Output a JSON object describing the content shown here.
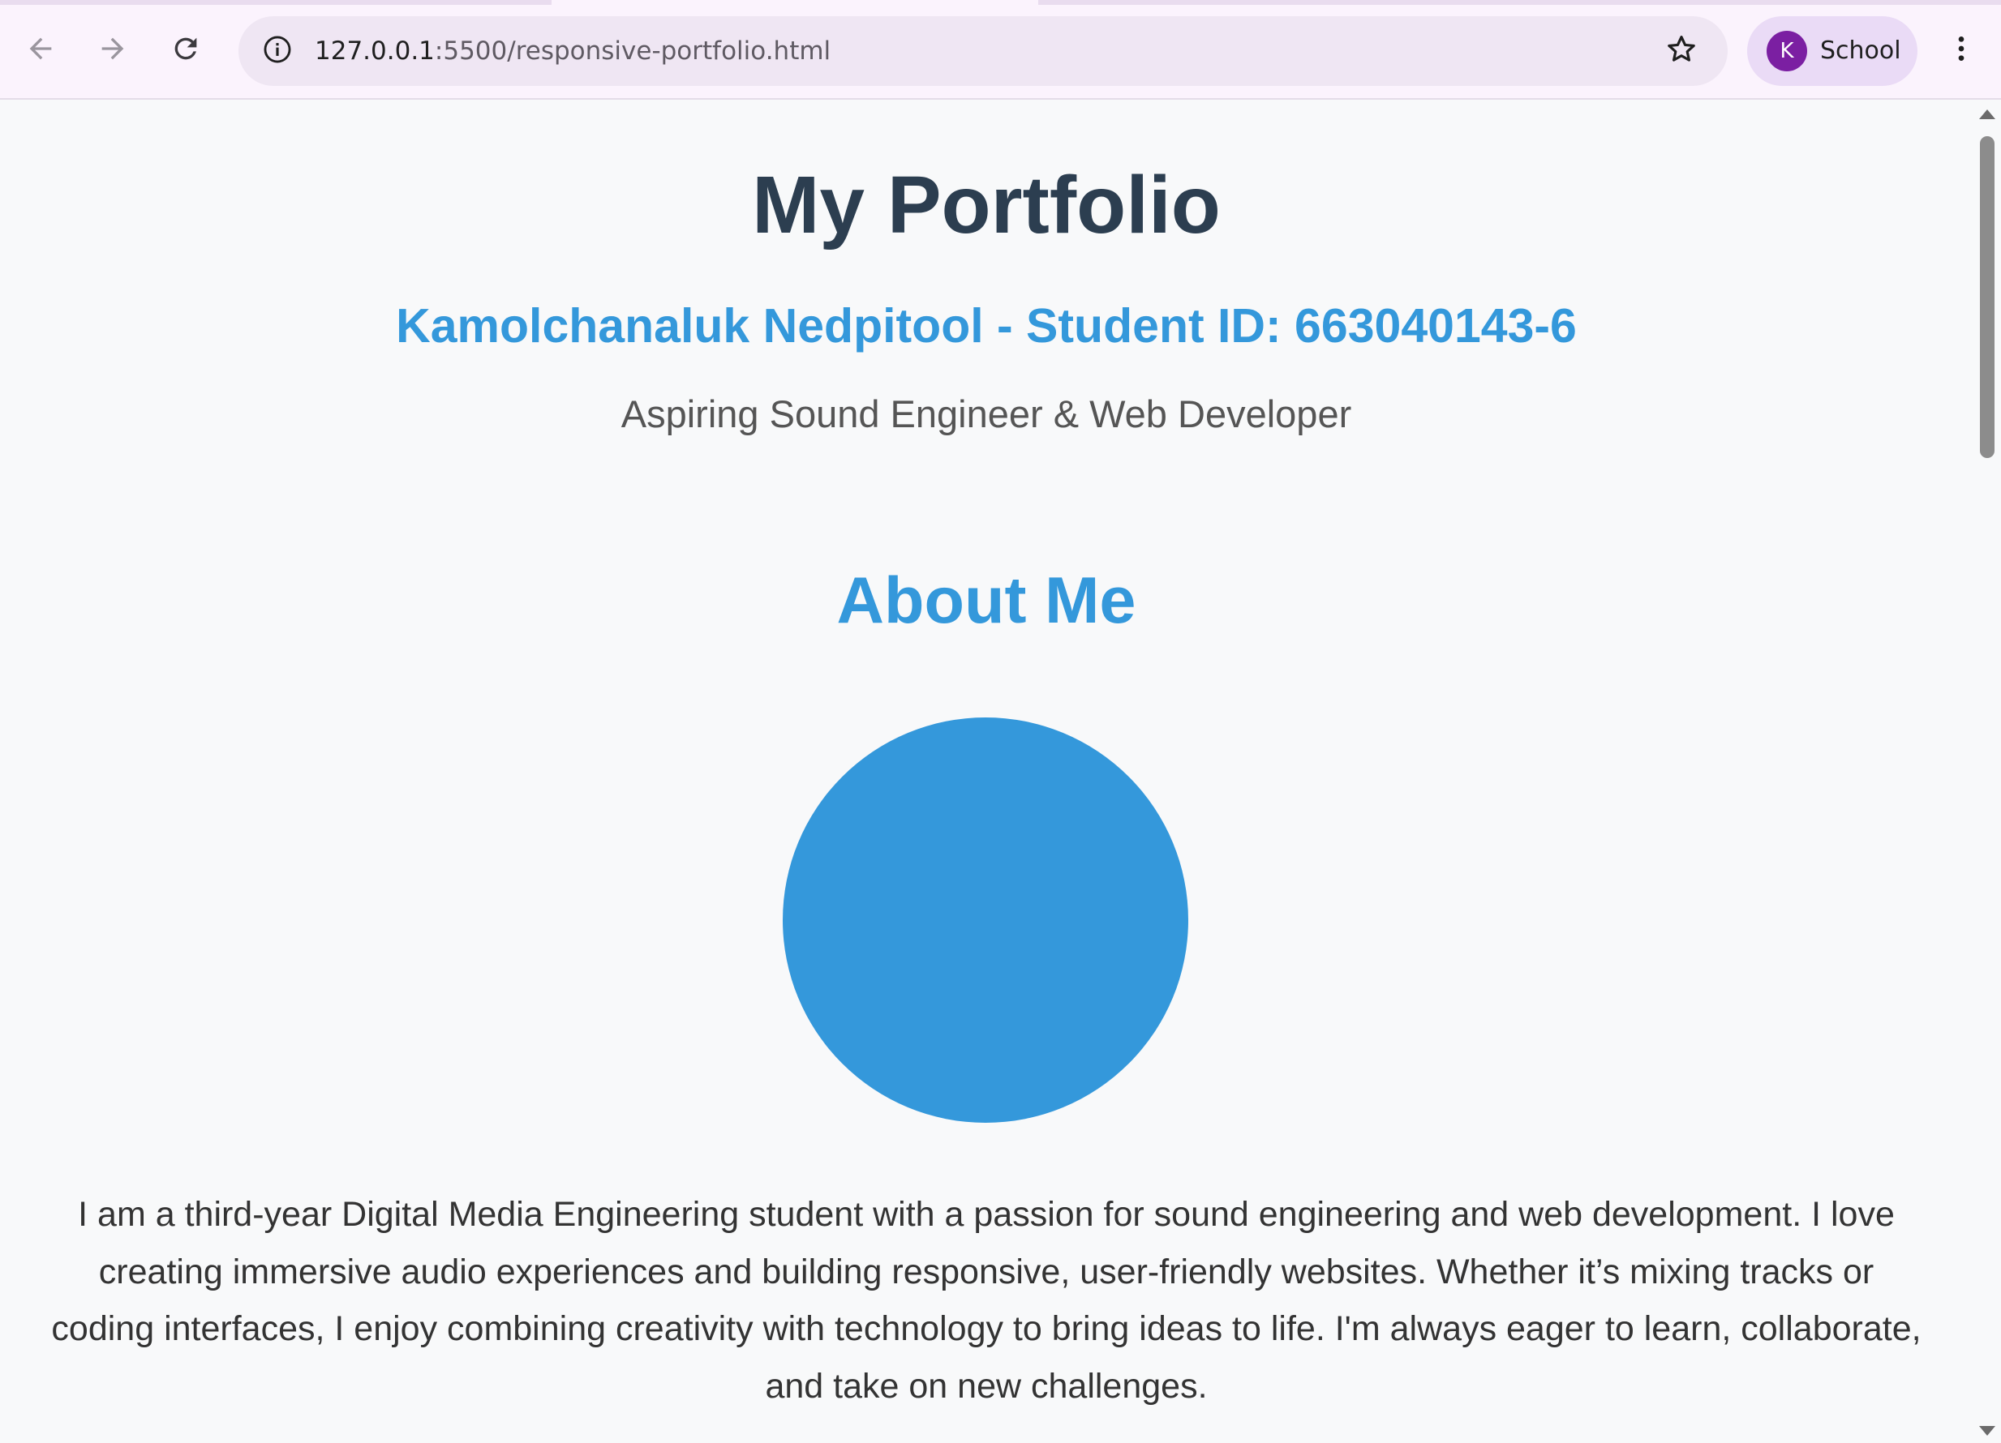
{
  "browser": {
    "url_host": "127.0.0.1",
    "url_path": ":5500/responsive-portfolio.html",
    "profile": {
      "initial": "K",
      "name": "School",
      "avatar_color": "#7b1fa2"
    },
    "icons": {
      "back": "back-arrow-icon",
      "forward": "forward-arrow-icon",
      "reload": "reload-icon",
      "site_info": "info-icon",
      "bookmark": "star-icon",
      "menu": "kebab-menu-icon"
    }
  },
  "page": {
    "title": "My Portfolio",
    "student": "Kamolchanaluk Nedpitool - Student ID: 663040143-6",
    "tagline": "Aspiring Sound Engineer & Web Developer",
    "about": {
      "heading": "About Me",
      "text": "I am a third-year Digital Media Engineering student with a passion for sound engineering and web development. I love creating immersive audio experiences and building responsive, user-friendly websites. Whether it’s mixing tracks or coding interfaces, I enjoy combining creativity with technology to bring ideas to life. I'm always eager to learn, collaborate, and take on new challenges."
    }
  },
  "colors": {
    "title": "#2c3e50",
    "accent": "#3498db",
    "tagline": "#555555",
    "body_text": "#333333",
    "page_bg": "#f8f9fa",
    "chrome_bg": "#fbf3fd"
  }
}
